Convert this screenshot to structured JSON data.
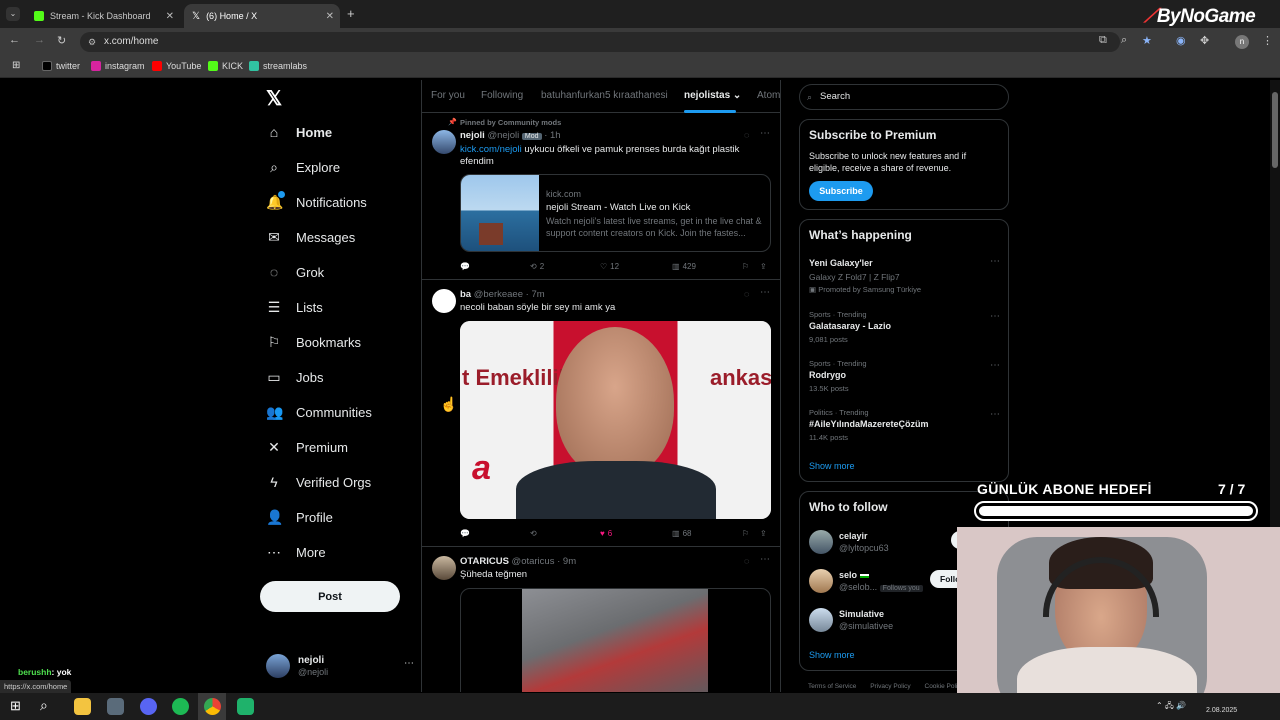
{
  "browser": {
    "tabs": [
      {
        "title": "Stream - Kick Dashboard",
        "active": false
      },
      {
        "title": "(6) Home / X",
        "active": true
      }
    ],
    "new_tab_label": "+",
    "url": "x.com/home",
    "bookmarks": [
      "twitter",
      "instagram",
      "YouTube",
      "KICK",
      "streamlabs"
    ],
    "profile_initial": "n",
    "status_url": "https://x.com/home"
  },
  "watermark": "ByNoGame",
  "nav": {
    "items": [
      {
        "label": "Home",
        "icon": "home-icon",
        "glyph": "⌂"
      },
      {
        "label": "Explore",
        "icon": "search-icon",
        "glyph": "⌕"
      },
      {
        "label": "Notifications",
        "icon": "bell-icon",
        "glyph": "🔔"
      },
      {
        "label": "Messages",
        "icon": "envelope-icon",
        "glyph": "✉"
      },
      {
        "label": "Grok",
        "icon": "grok-icon",
        "glyph": "◌"
      },
      {
        "label": "Lists",
        "icon": "list-icon",
        "glyph": "☰"
      },
      {
        "label": "Bookmarks",
        "icon": "bookmark-icon",
        "glyph": "⚐"
      },
      {
        "label": "Jobs",
        "icon": "briefcase-icon",
        "glyph": "▭"
      },
      {
        "label": "Communities",
        "icon": "people-icon",
        "glyph": "👥"
      },
      {
        "label": "Premium",
        "icon": "x-logo-icon",
        "glyph": "✕"
      },
      {
        "label": "Verified Orgs",
        "icon": "lightning-icon",
        "glyph": "ϟ"
      },
      {
        "label": "Profile",
        "icon": "person-icon",
        "glyph": "👤"
      },
      {
        "label": "More",
        "icon": "more-circle-icon",
        "glyph": "⋯"
      }
    ],
    "post_label": "Post",
    "account": {
      "name": "nejoli",
      "handle": "@nejoli"
    }
  },
  "feed": {
    "tabs": [
      "For you",
      "Following",
      "batuhanfurkan5 kıraathanesi",
      "nejolistas",
      "Atom"
    ],
    "active_tab": 3,
    "tweets": [
      {
        "pinned_label": "Pinned by Community mods",
        "name": "nejoli",
        "handle": "@nejoli",
        "badge": "Mod",
        "time": "· 1h",
        "link": "kick.com/nejoli",
        "text": "uykucu öfkeli ve pamuk prenses burda kağıt plastik efendim",
        "card": {
          "domain": "kick.com",
          "title": "nejoli Stream - Watch Live on Kick",
          "desc": "Watch nejoli's latest live streams, get in the live chat & support content creators on Kick. Join the fastes..."
        },
        "retweets": "2",
        "likes": "12",
        "views": "429"
      },
      {
        "name": "ba",
        "handle": "@berkeaee",
        "time": "· 7m",
        "text": "necoli baban söyle bir sey mi amk ya",
        "image_text_left": "t Emeklilik",
        "image_text_right": "ankası",
        "image_text_logo": "a",
        "likes": "6",
        "views": "68"
      },
      {
        "name": "OTARICUS",
        "handle": "@otaricus",
        "time": "· 9m",
        "text": "Şüheda teğmen"
      }
    ]
  },
  "right": {
    "search_placeholder": "Search",
    "premium": {
      "title": "Subscribe to Premium",
      "text": "Subscribe to unlock new features and if eligible, receive a share of revenue.",
      "button": "Subscribe"
    },
    "happening": {
      "title": "What’s happening",
      "trends": [
        {
          "meta": "",
          "name": "Yeni Galaxy'ler",
          "sub": "Galaxy Z Fold7 | Z Flip7",
          "promo": "Promoted by Samsung Türkiye"
        },
        {
          "meta": "Sports · Trending",
          "name": "Galatasaray - Lazio",
          "sub": "9,081 posts"
        },
        {
          "meta": "Sports · Trending",
          "name": "Rodrygo",
          "sub": "13.5K posts"
        },
        {
          "meta": "Politics · Trending",
          "name": "#AileYılındaMazereteÇözüm",
          "sub": "11.4K posts"
        }
      ],
      "show_more": "Show more"
    },
    "who_to_follow": {
      "title": "Who to follow",
      "users": [
        {
          "name": "celayir",
          "handle": "@lyltopcu63",
          "follows_you": ""
        },
        {
          "name": "selo",
          "handle": "@selob...",
          "follows_you": "Follows you"
        },
        {
          "name": "Simulative",
          "handle": "@simulativee",
          "follows_you": ""
        }
      ],
      "follow_label": "Fo",
      "follow_label_2": "Follo",
      "show_more": "Show more"
    },
    "footer": [
      "Terms of Service",
      "Privacy Policy",
      "Cookie Polic"
    ]
  },
  "stream": {
    "goal_title": "GÜNLÜK ABONE HEDEFİ",
    "goal_count": "7 / 7",
    "goal_progress": 1.0,
    "chat_user": "berushh",
    "chat_message": ": yok"
  },
  "taskbar": {
    "date": "2.08.2025"
  }
}
